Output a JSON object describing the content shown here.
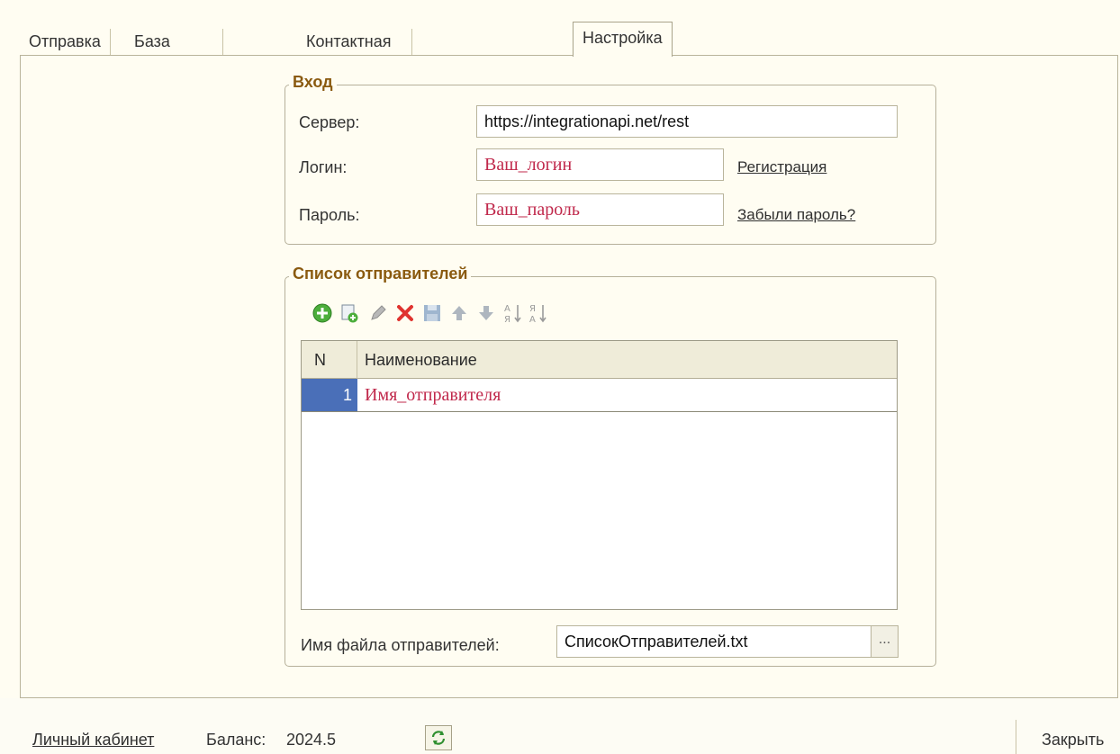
{
  "tabs": [
    {
      "label": "Отправка",
      "active": false
    },
    {
      "label": "База абонентов",
      "active": false
    },
    {
      "label": "Контактная информация",
      "active": false
    },
    {
      "label": "Настройка",
      "active": true
    }
  ],
  "login_group": {
    "title": "Вход",
    "server_label": "Сервер:",
    "server_value": "https://integrationapi.net/rest",
    "login_label": "Логин:",
    "login_value": "Ваш_логин",
    "register_link": "Регистрация",
    "password_label": "Пароль:",
    "password_value": "Ваш_пароль",
    "forgot_link": "Забыли пароль?"
  },
  "senders_group": {
    "title": "Список отправителей",
    "toolbar_icons": [
      "add-icon",
      "copy-icon",
      "edit-icon",
      "delete-icon",
      "save-icon",
      "move-up-icon",
      "move-down-icon",
      "sort-asc-icon",
      "sort-desc-icon"
    ],
    "table": {
      "columns": [
        "N",
        "Наименование"
      ],
      "rows": [
        {
          "n": "1",
          "name": "Имя_отправителя"
        }
      ]
    },
    "file_label": "Имя файла отправителей:",
    "file_value": "СписокОтправителей.txt",
    "browse_label": "..."
  },
  "status_bar": {
    "account_link": "Личный кабинет",
    "balance_label": "Баланс:",
    "balance_value": "2024.5",
    "close_label": "Закрыть"
  },
  "colors": {
    "background": "#fffdf2",
    "group_title": "#8a5a10",
    "highlight_value": "#c0284b",
    "selected_row": "#4a6fb8"
  }
}
